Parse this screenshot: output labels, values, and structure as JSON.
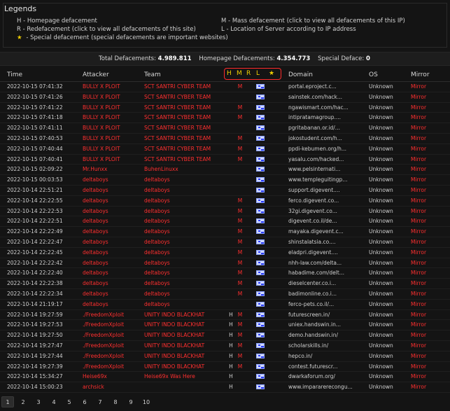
{
  "legend": {
    "title": "Legends",
    "left": [
      {
        "key": "H",
        "text": " - Homepage defacement"
      },
      {
        "key": "R",
        "text": " - Redefacement (click to view all defacements of this site)"
      },
      {
        "key": "★",
        "text": " - Special defacement (special defacements are important websites)"
      }
    ],
    "right": [
      {
        "key": "M",
        "text": " - Mass defacement (click to view all defacements of this IP)"
      },
      {
        "key": "L",
        "text": " - Location of Server according to IP address"
      }
    ]
  },
  "totals": {
    "total_label": "Total Defacements:",
    "total_value": "4.989.811",
    "homepage_label": "Homepage Defacements:",
    "homepage_value": "4.354.773",
    "special_label": "Special Deface:",
    "special_value": "0"
  },
  "table": {
    "headers": {
      "time": "Time",
      "attacker": "Attacker",
      "team": "Team",
      "h": "H",
      "m": "M",
      "r": "R",
      "l": "L",
      "star": "★",
      "domain": "Domain",
      "os": "OS",
      "mirror": "Mirror"
    },
    "rows": [
      {
        "time": "2022-10-15 07:41:32",
        "attacker": "BULLY X PLOIT",
        "team": "SCT SANTRI CYBER TEAM",
        "h": "",
        "m": "M",
        "r": "",
        "domain": "portal.eproject.c...",
        "os": "Unknown",
        "mirror": "Mirror"
      },
      {
        "time": "2022-10-15 07:41:26",
        "attacker": "BULLY X PLOIT",
        "team": "SCT SANTRI CYBER TEAM",
        "h": "",
        "m": "",
        "r": "",
        "domain": "sainstek.com/hack...",
        "os": "Unknown",
        "mirror": "Mirror"
      },
      {
        "time": "2022-10-15 07:41:22",
        "attacker": "BULLY X PLOIT",
        "team": "SCT SANTRI CYBER TEAM",
        "h": "",
        "m": "M",
        "r": "",
        "domain": "ngawismart.com/hac...",
        "os": "Unknown",
        "mirror": "Mirror"
      },
      {
        "time": "2022-10-15 07:41:18",
        "attacker": "BULLY X PLOIT",
        "team": "SCT SANTRI CYBER TEAM",
        "h": "",
        "m": "M",
        "r": "",
        "domain": "intipratamagroup....",
        "os": "Unknown",
        "mirror": "Mirror"
      },
      {
        "time": "2022-10-15 07:41:11",
        "attacker": "BULLY X PLOIT",
        "team": "SCT SANTRI CYBER TEAM",
        "h": "",
        "m": "",
        "r": "",
        "domain": "pgritabanan.or.id/...",
        "os": "Unknown",
        "mirror": "Mirror"
      },
      {
        "time": "2022-10-15 07:40:53",
        "attacker": "BULLY X PLOIT",
        "team": "SCT SANTRI CYBER TEAM",
        "h": "",
        "m": "M",
        "r": "",
        "domain": "jokostudent.com/h...",
        "os": "Unknown",
        "mirror": "Mirror"
      },
      {
        "time": "2022-10-15 07:40:44",
        "attacker": "BULLY X PLOIT",
        "team": "SCT SANTRI CYBER TEAM",
        "h": "",
        "m": "M",
        "r": "",
        "domain": "ppdi-kebumen.org/h...",
        "os": "Unknown",
        "mirror": "Mirror"
      },
      {
        "time": "2022-10-15 07:40:41",
        "attacker": "BULLY X PLOIT",
        "team": "SCT SANTRI CYBER TEAM",
        "h": "",
        "m": "M",
        "r": "",
        "domain": "yasalu.com/hacked...",
        "os": "Unknown",
        "mirror": "Mirror"
      },
      {
        "time": "2022-10-15 02:09:22",
        "attacker": "Mr.Hunxx",
        "team": "BuhenLinuxx",
        "h": "",
        "m": "",
        "r": "",
        "domain": "www.pelsinternati...",
        "os": "Unknown",
        "mirror": "Mirror"
      },
      {
        "time": "2022-10-15 00:03:53",
        "attacker": "deltaboys",
        "team": "deltaboys",
        "h": "",
        "m": "",
        "r": "",
        "domain": "www.templeguitingp...",
        "os": "Unknown",
        "mirror": "Mirror"
      },
      {
        "time": "2022-10-14 22:51:21",
        "attacker": "deltaboys",
        "team": "deltaboys",
        "h": "",
        "m": "",
        "r": "",
        "domain": "support.digevent....",
        "os": "Unknown",
        "mirror": "Mirror"
      },
      {
        "time": "2022-10-14 22:22:55",
        "attacker": "deltaboys",
        "team": "deltaboys",
        "h": "",
        "m": "M",
        "r": "",
        "domain": "ferco.digevent.co...",
        "os": "Unknown",
        "mirror": "Mirror"
      },
      {
        "time": "2022-10-14 22:22:53",
        "attacker": "deltaboys",
        "team": "deltaboys",
        "h": "",
        "m": "M",
        "r": "",
        "domain": "32gi.digevent.co...",
        "os": "Unknown",
        "mirror": "Mirror"
      },
      {
        "time": "2022-10-14 22:22:51",
        "attacker": "deltaboys",
        "team": "deltaboys",
        "h": "",
        "m": "M",
        "r": "",
        "domain": "digevent.co.il/de...",
        "os": "Unknown",
        "mirror": "Mirror"
      },
      {
        "time": "2022-10-14 22:22:49",
        "attacker": "deltaboys",
        "team": "deltaboys",
        "h": "",
        "m": "M",
        "r": "",
        "domain": "mayaka.digevent.c...",
        "os": "Unknown",
        "mirror": "Mirror"
      },
      {
        "time": "2022-10-14 22:22:47",
        "attacker": "deltaboys",
        "team": "deltaboys",
        "h": "",
        "m": "M",
        "r": "",
        "domain": "shinstalatsia.co....",
        "os": "Unknown",
        "mirror": "Mirror"
      },
      {
        "time": "2022-10-14 22:22:45",
        "attacker": "deltaboys",
        "team": "deltaboys",
        "h": "",
        "m": "M",
        "r": "",
        "domain": "eladpri.digevent....",
        "os": "Unknown",
        "mirror": "Mirror"
      },
      {
        "time": "2022-10-14 22:22:42",
        "attacker": "deltaboys",
        "team": "deltaboys",
        "h": "",
        "m": "M",
        "r": "",
        "domain": "nhh-law.com/delta...",
        "os": "Unknown",
        "mirror": "Mirror"
      },
      {
        "time": "2022-10-14 22:22:40",
        "attacker": "deltaboys",
        "team": "deltaboys",
        "h": "",
        "m": "M",
        "r": "",
        "domain": "habadime.com/delt...",
        "os": "Unknown",
        "mirror": "Mirror"
      },
      {
        "time": "2022-10-14 22:22:38",
        "attacker": "deltaboys",
        "team": "deltaboys",
        "h": "",
        "m": "M",
        "r": "",
        "domain": "dieselcenter.co.i...",
        "os": "Unknown",
        "mirror": "Mirror"
      },
      {
        "time": "2022-10-14 22:22:34",
        "attacker": "deltaboys",
        "team": "deltaboys",
        "h": "",
        "m": "M",
        "r": "",
        "domain": "badimonline.co.i...",
        "os": "Unknown",
        "mirror": "Mirror"
      },
      {
        "time": "2022-10-14 21:19:17",
        "attacker": "deltaboys",
        "team": "deltaboys",
        "h": "",
        "m": "",
        "r": "",
        "domain": "ferco-pets.co.il/...",
        "os": "Unknown",
        "mirror": "Mirror"
      },
      {
        "time": "2022-10-14 19:27:59",
        "attacker": "./FreedomXploit",
        "team": "UNITY INDO BLACKHAT",
        "h": "H",
        "m": "M",
        "r": "",
        "domain": "futurescreen.in/",
        "os": "Unknown",
        "mirror": "Mirror"
      },
      {
        "time": "2022-10-14 19:27:53",
        "attacker": "./FreedomXploit",
        "team": "UNITY INDO BLACKHAT",
        "h": "H",
        "m": "M",
        "r": "",
        "domain": "uniex.handswin.in...",
        "os": "Unknown",
        "mirror": "Mirror"
      },
      {
        "time": "2022-10-14 19:27:50",
        "attacker": "./FreedomXploit",
        "team": "UNITY INDO BLACKHAT",
        "h": "H",
        "m": "M",
        "r": "",
        "domain": "demo.handswin.in/",
        "os": "Unknown",
        "mirror": "Mirror"
      },
      {
        "time": "2022-10-14 19:27:47",
        "attacker": "./FreedomXploit",
        "team": "UNITY INDO BLACKHAT",
        "h": "H",
        "m": "M",
        "r": "",
        "domain": "scholarskills.in/",
        "os": "Unknown",
        "mirror": "Mirror"
      },
      {
        "time": "2022-10-14 19:27:44",
        "attacker": "./FreedomXploit",
        "team": "UNITY INDO BLACKHAT",
        "h": "H",
        "m": "M",
        "r": "",
        "domain": "hepco.in/",
        "os": "Unknown",
        "mirror": "Mirror"
      },
      {
        "time": "2022-10-14 19:27:39",
        "attacker": "./FreedomXploit",
        "team": "UNITY INDO BLACKHAT",
        "h": "H",
        "m": "M",
        "r": "",
        "domain": "contest.futurescr...",
        "os": "Unknown",
        "mirror": "Mirror"
      },
      {
        "time": "2022-10-14 15:34:27",
        "attacker": "Heise69x",
        "team": "Heise69x Was Here",
        "h": "H",
        "m": "",
        "r": "",
        "domain": "dwarkaforum.org/",
        "os": "Unknown",
        "mirror": "Mirror"
      },
      {
        "time": "2022-10-14 15:00:23",
        "attacker": "archsick",
        "team": "",
        "h": "H",
        "m": "",
        "r": "",
        "domain": "www.impararerecongu...",
        "os": "Unknown",
        "mirror": "Mirror"
      }
    ]
  },
  "pagination": {
    "pages": [
      "1",
      "2",
      "3",
      "4",
      "5",
      "6",
      "7",
      "8",
      "9",
      "10"
    ],
    "active": "1"
  },
  "colors": {
    "background": "#141414",
    "accent_red": "#ff2f2f",
    "highlight_red": "#ff2b2b",
    "star_yellow": "#f2d000"
  },
  "icons": {
    "flag": "server-location-flag-icon",
    "star": "special-deface-star-icon"
  }
}
